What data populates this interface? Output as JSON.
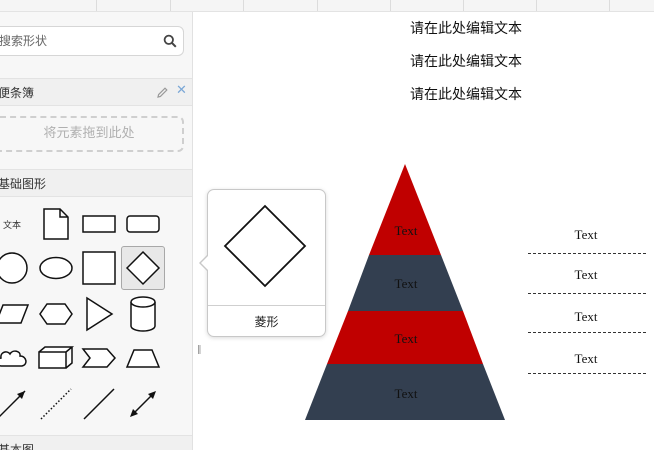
{
  "sidebar": {
    "search": {
      "placeholder": "搜索形状",
      "value": ""
    },
    "scratchpad": {
      "title": "便条簿",
      "drop_hint": "将元素拖到此处"
    },
    "basic_shapes": {
      "title": "基础图形",
      "text_item": "文本"
    },
    "next_section": {
      "title": "基本图"
    }
  },
  "tooltip": {
    "shape_name": "菱形"
  },
  "canvas": {
    "edit_texts": [
      "请在此处编辑文本",
      "请在此处编辑文本",
      "请在此处编辑文本"
    ],
    "pyramid": {
      "labels": [
        "Text",
        "Text",
        "Text",
        "Text"
      ],
      "colors": [
        "#c00000",
        "#333f50",
        "#c00000",
        "#333f50"
      ]
    },
    "side_labels": [
      "Text",
      "Text",
      "Text",
      "Text"
    ]
  }
}
